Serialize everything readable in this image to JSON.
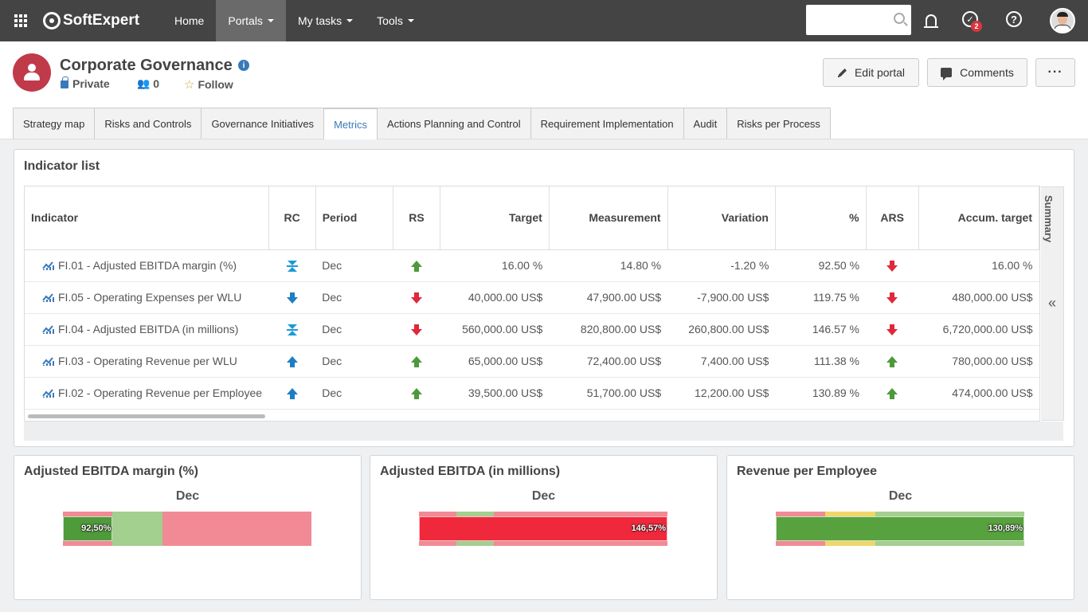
{
  "topbar": {
    "brand": "SoftExpert",
    "nav": [
      {
        "label": "Home"
      },
      {
        "label": "Portals"
      },
      {
        "label": "My tasks"
      },
      {
        "label": "Tools"
      }
    ],
    "task_badge": "2"
  },
  "portal": {
    "title": "Corporate Governance",
    "visibility": "Private",
    "members": "0",
    "follow": "Follow",
    "edit_label": "Edit portal",
    "comments_label": "Comments",
    "more_label": "···"
  },
  "tabs": [
    {
      "label": "Strategy map"
    },
    {
      "label": "Risks and Controls"
    },
    {
      "label": "Governance Initiatives"
    },
    {
      "label": "Metrics",
      "active": true
    },
    {
      "label": "Actions Planning and Control"
    },
    {
      "label": "Requirement Implementation"
    },
    {
      "label": "Audit"
    },
    {
      "label": "Risks per Process"
    }
  ],
  "indicator_list": {
    "title": "Indicator list",
    "summary_label": "Summary",
    "columns": [
      "Indicator",
      "RC",
      "Period",
      "RS",
      "Target",
      "Measurement",
      "Variation",
      "%",
      "ARS",
      "Accum. target"
    ],
    "rows": [
      {
        "indicator": "FI.01 - Adjusted EBITDA margin (%)",
        "rc": "range",
        "period": "Dec",
        "rs": "up-green",
        "target": "16.00 %",
        "measurement": "14.80 %",
        "variation": "-1.20 %",
        "pct": "92.50 %",
        "ars": "down-red",
        "accum_target": "16.00 %"
      },
      {
        "indicator": "FI.05 - Operating Expenses per WLU",
        "rc": "down-blue",
        "period": "Dec",
        "rs": "down-red",
        "target": "40,000.00 US$",
        "measurement": "47,900.00 US$",
        "variation": "-7,900.00 US$",
        "pct": "119.75 %",
        "ars": "down-red",
        "accum_target": "480,000.00 US$"
      },
      {
        "indicator": "FI.04 - Adjusted EBITDA (in millions)",
        "rc": "range",
        "period": "Dec",
        "rs": "down-red",
        "target": "560,000.00 US$",
        "measurement": "820,800.00 US$",
        "variation": "260,800.00 US$",
        "pct": "146.57 %",
        "ars": "down-red",
        "accum_target": "6,720,000.00 US$"
      },
      {
        "indicator": "FI.03 - Operating Revenue per WLU",
        "rc": "up-blue",
        "period": "Dec",
        "rs": "up-green",
        "target": "65,000.00 US$",
        "measurement": "72,400.00 US$",
        "variation": "7,400.00 US$",
        "pct": "111.38 %",
        "ars": "up-green",
        "accum_target": "780,000.00 US$"
      },
      {
        "indicator": "FI.02 - Operating Revenue per Employee",
        "rc": "up-blue",
        "period": "Dec",
        "rs": "up-green",
        "target": "39,500.00 US$",
        "measurement": "51,700.00 US$",
        "variation": "12,200.00 US$",
        "pct": "130.89 %",
        "ars": "up-green",
        "accum_target": "474,000.00 US$"
      }
    ]
  },
  "gauges": [
    {
      "title": "Adjusted EBITDA margin (%)",
      "period": "Dec",
      "value_label": "92,50%",
      "value": 0.925,
      "bar_color": "#4f9a3a",
      "bands": [
        {
          "share": 0.2,
          "color": "#f18a95"
        },
        {
          "share": 0.2,
          "color": "#a3cf8f"
        },
        {
          "share": 0.6,
          "color": "#f18a95"
        }
      ],
      "fill": {
        "share": 0.2,
        "color": "#4f9a3a"
      }
    },
    {
      "title": "Adjusted EBITDA (in millions)",
      "period": "Dec",
      "value_label": "146,57%",
      "value": 1.4657,
      "bar_color": "#f0283c",
      "bands": [
        {
          "share": 0.15,
          "color": "#f18a95"
        },
        {
          "share": 0.15,
          "color": "#a3cf8f"
        },
        {
          "share": 0.7,
          "color": "#f18a95"
        }
      ],
      "fill": {
        "share": 1.0,
        "color": "#f0283c"
      }
    },
    {
      "title": "Revenue per Employee",
      "period": "Dec",
      "value_label": "130,89%",
      "value": 1.3089,
      "bar_color": "#57a23e",
      "bands": [
        {
          "share": 0.2,
          "color": "#f18a95"
        },
        {
          "share": 0.2,
          "color": "#f0d66a"
        },
        {
          "share": 0.6,
          "color": "#a3cf8f"
        }
      ],
      "fill": {
        "share": 1.0,
        "color": "#57a23e"
      }
    }
  ]
}
